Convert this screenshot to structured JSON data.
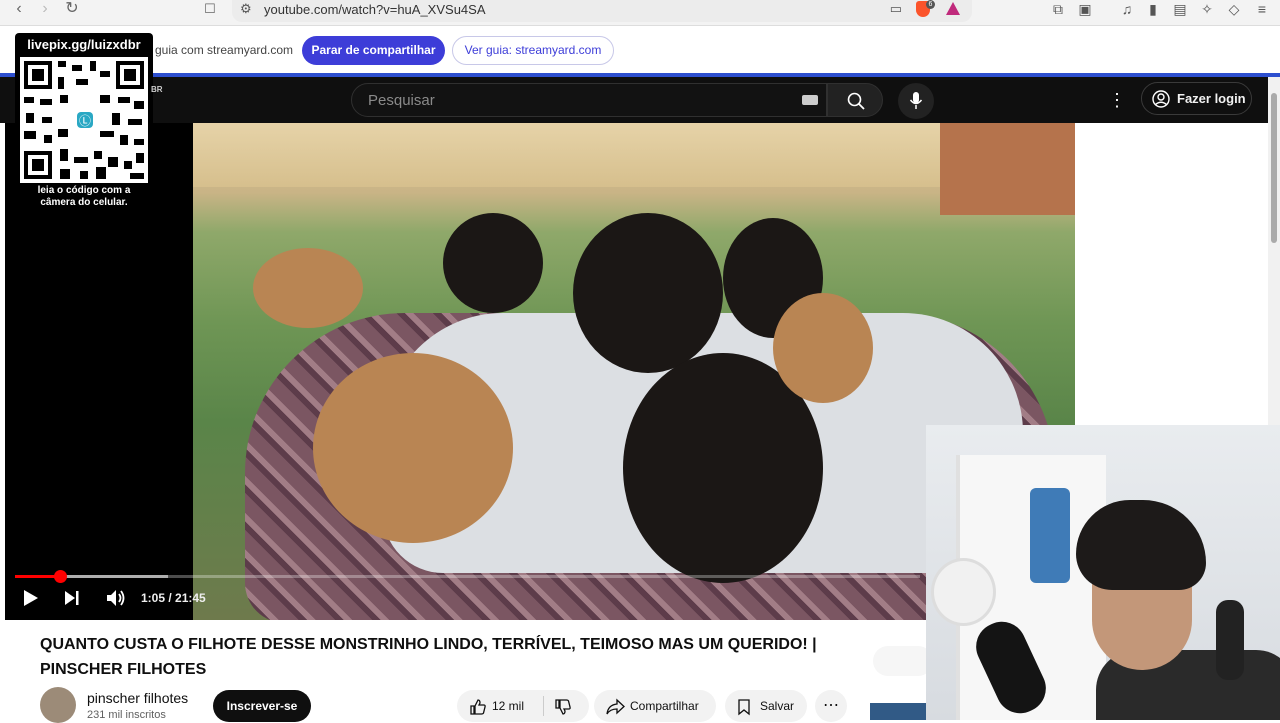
{
  "browser": {
    "url": "youtube.com/watch?v=huA_XVSu4SA"
  },
  "streamyard": {
    "share_text": "guia com streamyard.com",
    "stop_label": "Parar de compartilhar",
    "guide_label": "Ver guia: streamyard.com"
  },
  "overlay": {
    "qr_url": "livepix.gg/luizxdbr",
    "qr_note_line1": "leia o código com a",
    "qr_note_line2": "câmera do celular.",
    "channel_tag": "BR"
  },
  "youtube": {
    "search_placeholder": "Pesquisar",
    "login_label": "Fazer login",
    "time": "1:05 / 21:45",
    "progress_fraction": 0.05,
    "video_title": "QUANTO CUSTA O FILHOTE DESSE MONSTRINHO LINDO, TERRÍVEL, TEIMOSO MAS UM QUERIDO! | PINSCHER FILHOTES",
    "channel_name": "pinscher filhotes",
    "channel_subs": "231 mil inscritos",
    "subscribe_label": "Inscrever-se",
    "likes": "12 mil",
    "share_label": "Compartilhar",
    "save_label": "Salvar"
  },
  "colors": {
    "streamyard_accent": "#3d3dd8",
    "youtube_red": "#ff0000"
  }
}
